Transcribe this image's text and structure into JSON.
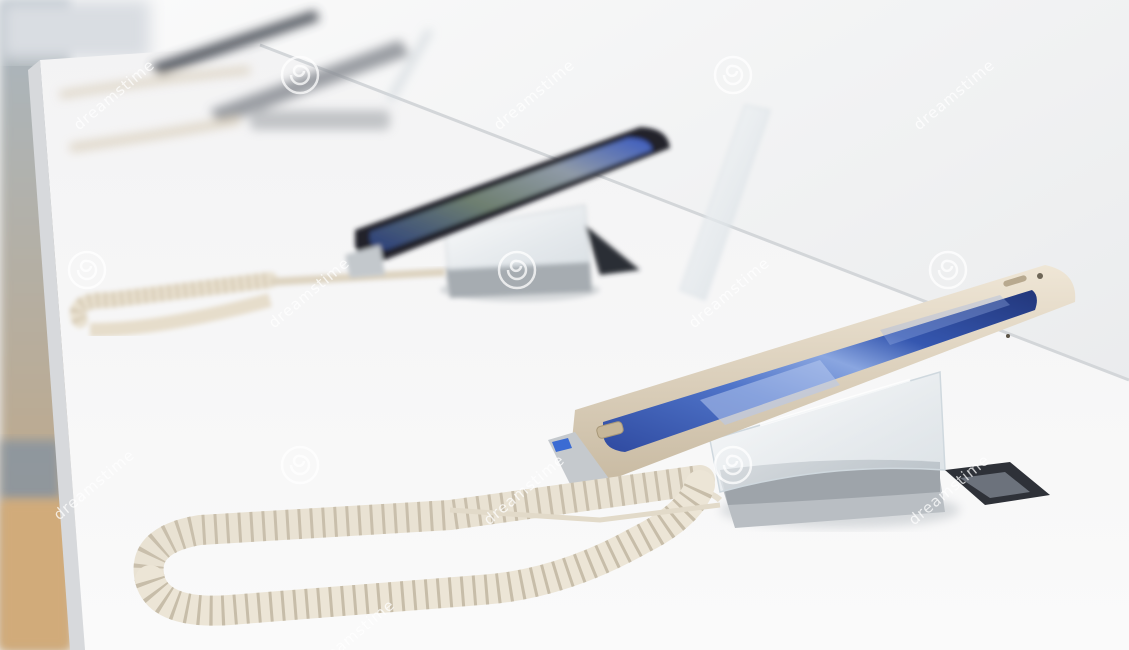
{
  "image": {
    "watermark_text": "dreamstime",
    "colors": {
      "wall": "#f1f2f3",
      "table_top": "#f4f4f4",
      "table_edge": "#d9dadc",
      "floor": "#c9a77e",
      "phone_frame": "#e2d6c2",
      "screen_blue": "#3d5fb8",
      "cable": "#ebe4d6",
      "acrylic": "#dfe6ea"
    }
  }
}
